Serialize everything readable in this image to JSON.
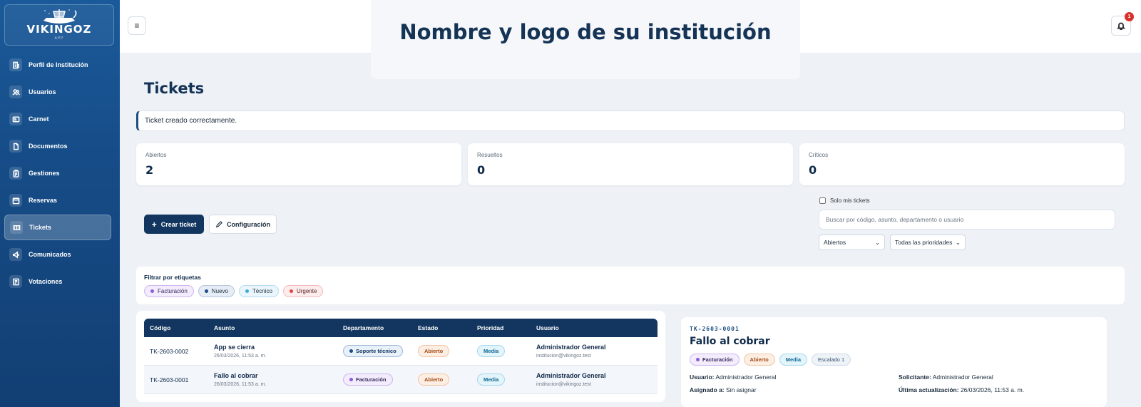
{
  "logo": {
    "name": "VIKINGOZ",
    "sub": "APP"
  },
  "sidebar": {
    "items": [
      {
        "label": "Perfil de Institución",
        "icon": "building-icon"
      },
      {
        "label": "Usuarios",
        "icon": "users-icon"
      },
      {
        "label": "Carnet",
        "icon": "id-card-icon"
      },
      {
        "label": "Documentos",
        "icon": "document-icon"
      },
      {
        "label": "Gestiones",
        "icon": "clipboard-icon"
      },
      {
        "label": "Reservas",
        "icon": "calendar-icon"
      },
      {
        "label": "Tickets",
        "icon": "ticket-icon",
        "active": true
      },
      {
        "label": "Comunicados",
        "icon": "megaphone-icon"
      },
      {
        "label": "Votaciones",
        "icon": "ballot-icon"
      }
    ]
  },
  "header": {
    "menu_icon": "≡",
    "brand_title": "Nombre y logo de su institución",
    "notification_count": "1"
  },
  "page": {
    "title": "Tickets",
    "alert": "Ticket creado correctamente."
  },
  "stats": [
    {
      "label": "Abiertos",
      "value": "2"
    },
    {
      "label": "Resueltos",
      "value": "0"
    },
    {
      "label": "Críticos",
      "value": "0"
    }
  ],
  "actions": {
    "create_label": "Crear ticket",
    "config_label": "Configuración"
  },
  "filters": {
    "only_mine_label": "Solo mis tickets",
    "search_placeholder": "Buscar por código, asunto, departamento o usuario",
    "status_select": "Abiertos",
    "priority_select": "Todas las prioridades",
    "tags_title": "Filtrar por etiquetas",
    "tags": [
      {
        "label": "Facturación",
        "color": "#8e5cd9"
      },
      {
        "label": "Nuevo",
        "color": "#1c4d80"
      },
      {
        "label": "Técnico",
        "color": "#3aaed8"
      },
      {
        "label": "Urgente",
        "color": "#e0453e"
      }
    ]
  },
  "table": {
    "columns": [
      "Código",
      "Asunto",
      "Departamento",
      "Estado",
      "Prioridad",
      "Usuario"
    ],
    "rows": [
      {
        "code": "TK-2603-0002",
        "subject": "App se cierra",
        "date": "26/03/2026, 11:53 a. m.",
        "department": "Soporte técnico",
        "status": "Abierto",
        "priority": "Media",
        "user": "Administrador General",
        "email": "institucion@vikingoz.test"
      },
      {
        "code": "TK-2603-0001",
        "subject": "Fallo al cobrar",
        "date": "26/03/2026, 11:53 a. m.",
        "department": "Facturación",
        "status": "Abierto",
        "priority": "Media",
        "user": "Administrador General",
        "email": "institucion@vikingoz.test"
      }
    ]
  },
  "detail": {
    "code": "TK-2603-0001",
    "title": "Fallo al cobrar",
    "tags": [
      "Facturación",
      "Abierto",
      "Media",
      "Escalado 1"
    ],
    "user_label": "Usuario:",
    "user_value": "Administrador General",
    "requester_label": "Solicitante:",
    "requester_value": "Administrador General",
    "assigned_label": "Asignado a:",
    "assigned_value": "Sin asignar",
    "updated_label": "Última actualización:",
    "updated_value": "26/03/2026, 11:53 a. m."
  }
}
